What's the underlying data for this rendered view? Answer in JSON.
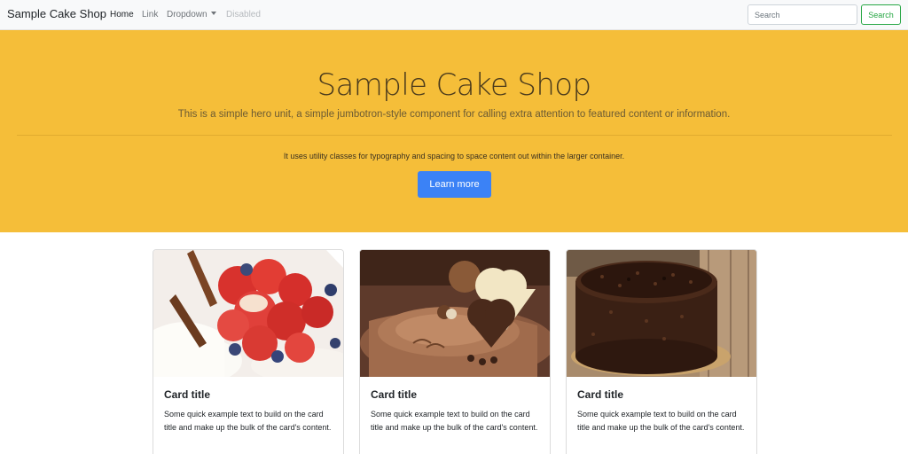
{
  "navbar": {
    "brand": "Sample Cake Shop",
    "links": [
      {
        "label": "Home"
      },
      {
        "label": "Link"
      },
      {
        "label": "Dropdown"
      },
      {
        "label": "Disabled"
      }
    ],
    "search": {
      "placeholder": "Search",
      "button_label": "Search"
    }
  },
  "hero": {
    "title": "Sample Cake Shop",
    "lead": "This is a simple hero unit, a simple jumbotron-style component for calling extra attention to featured content or information.",
    "text": "It uses utility classes for typography and spacing to space content out within the larger container.",
    "button_label": "Learn more"
  },
  "cards": [
    {
      "title": "Card title",
      "text": "Some quick example text to build on the card title and make up the bulk of the card's content.",
      "image": "strawberry-cake-photo"
    },
    {
      "title": "Card title",
      "text": "Some quick example text to build on the card title and make up the bulk of the card's content.",
      "image": "chocolate-heart-cake-photo"
    },
    {
      "title": "Card title",
      "text": "Some quick example text to build on the card title and make up the bulk of the card's content.",
      "image": "chocolate-cake-photo"
    }
  ],
  "colors": {
    "hero_bg": "#f5be39",
    "primary": "#3b82f6",
    "success": "#28a745"
  }
}
